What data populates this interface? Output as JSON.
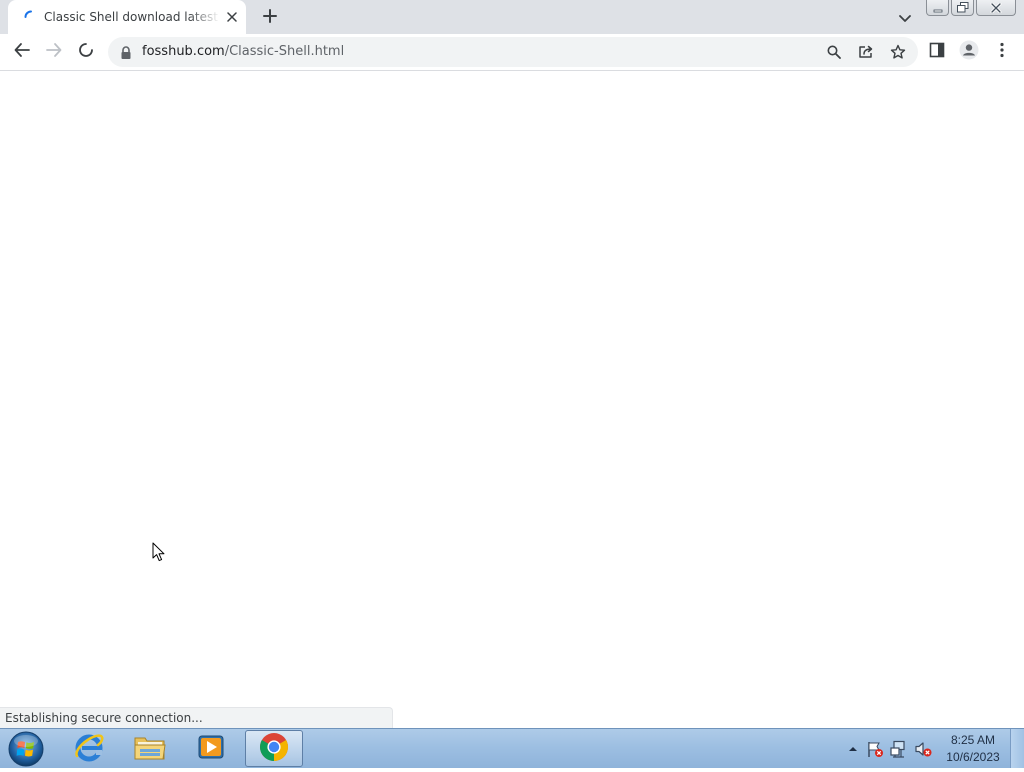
{
  "browser": {
    "tab": {
      "title": "Classic Shell download latest version",
      "spinner_icon": "loading-spinner-icon",
      "close_icon": "close-icon"
    },
    "new_tab_icon": "plus-icon",
    "tab_search_icon": "chevron-down-icon",
    "window_controls": [
      "minimize-icon",
      "restore-icon",
      "close-icon"
    ],
    "toolbar": {
      "back_icon": "back-arrow-icon",
      "forward_icon": "forward-arrow-icon",
      "stop_icon": "stop-loading-icon",
      "url_host": "fosshub.com",
      "url_path": "/Classic-Shell.html",
      "omnibox_icons": [
        "search-icon",
        "share-icon",
        "star-icon"
      ],
      "side_panel_icon": "side-panel-icon",
      "profile_icon": "profile-avatar-icon",
      "menu_icon": "kebab-menu-icon"
    },
    "status_text": "Establishing secure connection..."
  },
  "taskbar": {
    "start_icon": "windows-start-orb-icon",
    "pinned": [
      {
        "name": "internet-explorer-icon",
        "active": false
      },
      {
        "name": "file-explorer-icon",
        "active": false
      },
      {
        "name": "media-player-icon",
        "active": false
      },
      {
        "name": "chrome-icon",
        "active": true
      }
    ],
    "tray_icons": [
      "show-hidden-icons-arrow",
      "action-center-flag-icon",
      "network-icon",
      "volume-muted-icon"
    ],
    "clock": {
      "time": "8:25 AM",
      "date": "10/6/2023"
    }
  },
  "colors": {
    "tabstrip": "#dee1e6",
    "omnibox": "#f1f3f4",
    "taskbar": "#9dbfe2"
  }
}
